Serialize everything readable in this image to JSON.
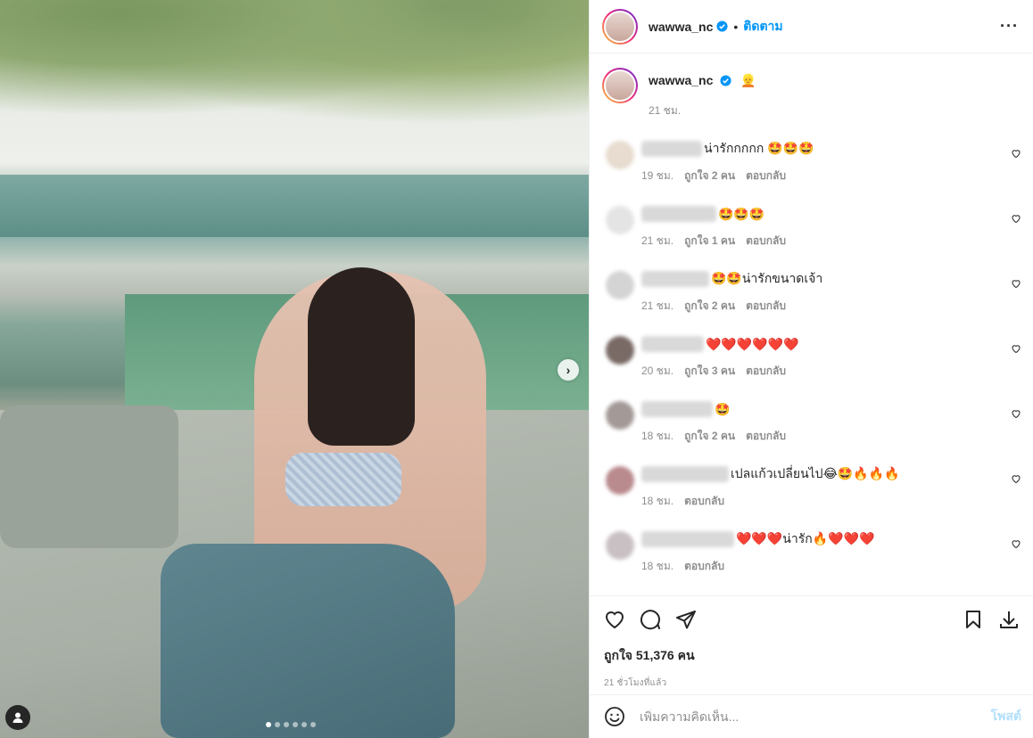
{
  "header": {
    "username": "wawwa_nc",
    "separator": "•",
    "follow_label": "ติดตาม",
    "more_label": "···"
  },
  "caption": {
    "username": "wawwa_nc",
    "emoji": "👱",
    "time": "21 ชม."
  },
  "comments": [
    {
      "text": "น่ารักกกกก 🤩🤩🤩",
      "time": "19 ชม.",
      "likes": "ถูกใจ 2 คน",
      "reply": "ตอบกลับ"
    },
    {
      "text": "🤩🤩🤩",
      "time": "21 ชม.",
      "likes": "ถูกใจ 1 คน",
      "reply": "ตอบกลับ"
    },
    {
      "text": "🤩🤩น่ารักขนาดเจ้า",
      "time": "21 ชม.",
      "likes": "ถูกใจ 2 คน",
      "reply": "ตอบกลับ"
    },
    {
      "text": "❤️❤️❤️❤️❤️❤️",
      "time": "20 ชม.",
      "likes": "ถูกใจ 3 คน",
      "reply": "ตอบกลับ"
    },
    {
      "text": "🤩",
      "time": "18 ชม.",
      "likes": "ถูกใจ 2 คน",
      "reply": "ตอบกลับ"
    },
    {
      "text": "เปลแก้วเปลี่ยนไป😂🤩🔥🔥🔥",
      "time": "18 ชม.",
      "reply": "ตอบกลับ"
    },
    {
      "text": "❤️❤️❤️น่ารัก🔥❤️❤️❤️",
      "time": "18 ชม.",
      "reply": "ตอบกลับ"
    }
  ],
  "actions": {
    "likes_count": "ถูกใจ 51,376 คน",
    "posted": "21 ชั่วโมงที่แล้ว"
  },
  "add_comment": {
    "placeholder": "เพิ่มความคิดเห็น...",
    "post_label": "โพสต์"
  },
  "media": {
    "next_arrow": "›",
    "slide_count": 6,
    "active_slide": 1
  },
  "colors": {
    "accent": "#0095f6",
    "post_disabled": "#b2dffc",
    "muted": "#8e8e8e"
  }
}
